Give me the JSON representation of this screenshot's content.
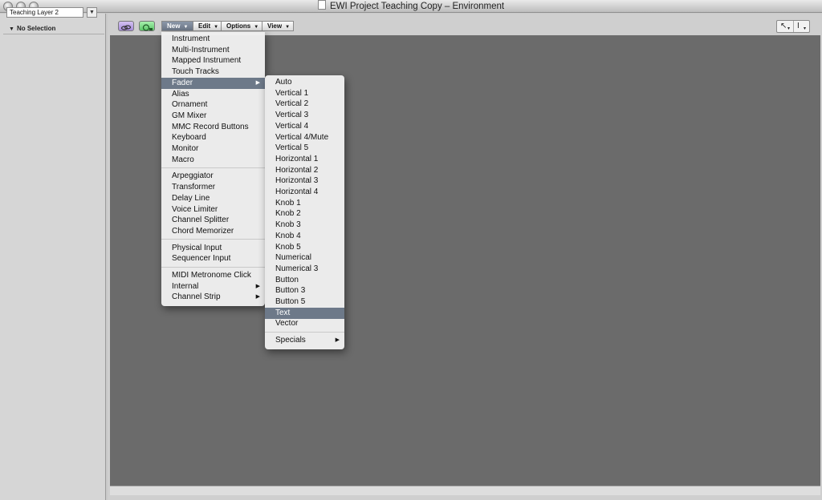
{
  "window": {
    "title": "EWI Project Teaching Copy – Environment"
  },
  "sidebar": {
    "layer_select": "Teaching Layer 2",
    "selection_header": "No Selection"
  },
  "toolbar": {
    "link_icon": "link-icon",
    "midi_icon": "midi-out-icon",
    "menus": [
      "New",
      "Edit",
      "Options",
      "View"
    ],
    "pointer_icon": "pointer-tool-icon",
    "text_icon": "text-tool-icon"
  },
  "new_menu": {
    "groups": [
      [
        "Instrument",
        "Multi-Instrument",
        "Mapped Instrument",
        "Touch Tracks",
        "Fader",
        "Alias",
        "Ornament",
        "GM Mixer",
        "MMC Record Buttons",
        "Keyboard",
        "Monitor",
        "Macro"
      ],
      [
        "Arpeggiator",
        "Transformer",
        "Delay Line",
        "Voice Limiter",
        "Channel Splitter",
        "Chord Memorizer"
      ],
      [
        "Physical Input",
        "Sequencer Input"
      ],
      [
        "MIDI Metronome Click",
        "Internal",
        "Channel Strip"
      ]
    ],
    "highlighted": "Fader",
    "submenu_items": [
      "Fader",
      "Internal",
      "Channel Strip"
    ]
  },
  "fader_menu": {
    "groups": [
      [
        "Auto",
        "Vertical 1",
        "Vertical 2",
        "Vertical 3",
        "Vertical 4",
        "Vertical 4/Mute",
        "Vertical 5",
        "Horizontal 1",
        "Horizontal 2",
        "Horizontal 3",
        "Horizontal 4",
        "Knob 1",
        "Knob 2",
        "Knob 3",
        "Knob 4",
        "Knob 5",
        "Numerical",
        "Numerical 3",
        "Button",
        "Button 3",
        "Button 5",
        "Text",
        "Vector"
      ],
      [
        "Specials"
      ]
    ],
    "highlighted": "Text",
    "submenu_items": [
      "Specials"
    ]
  },
  "colors": {
    "canvas": "#6b6b6b",
    "menu_highlight": "#6d7989",
    "link_button": "#b59be0",
    "midi_button": "#6fd27a"
  }
}
